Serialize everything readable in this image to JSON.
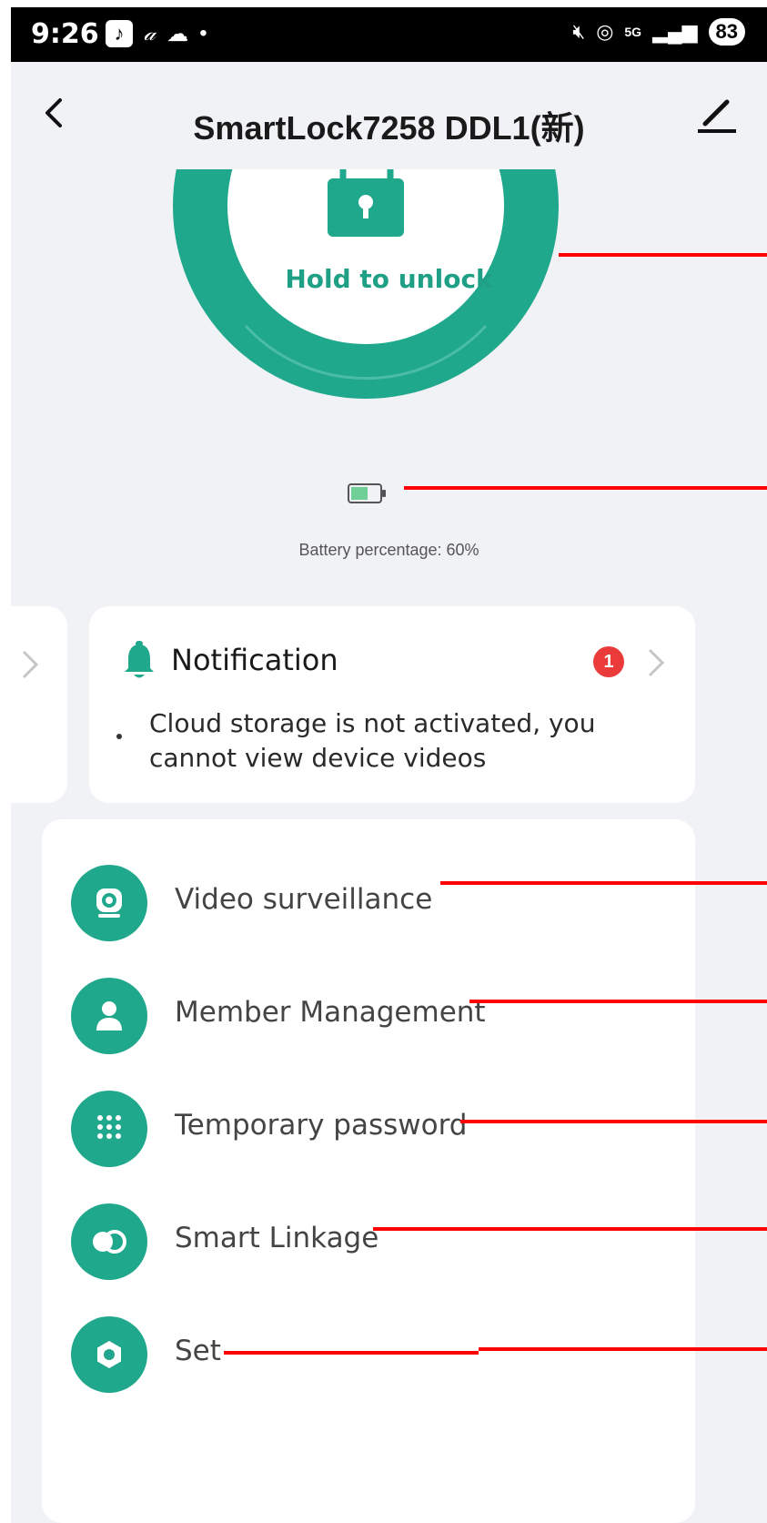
{
  "status_bar": {
    "time": "9:26",
    "battery": "83",
    "icons": [
      "tiktok-icon",
      "signature-icon",
      "cloud-icon",
      "dot-icon",
      "mute-icon",
      "hotspot-icon",
      "5g-icon",
      "signal-icon"
    ]
  },
  "app_bar": {
    "title": "SmartLock7258  DDL1(新)",
    "back_icon": "chevron-left-icon",
    "edit_icon": "pencil-icon"
  },
  "unlock": {
    "label": "Hold to unlock",
    "icon": "padlock-icon",
    "accent": "#1fa88c"
  },
  "battery": {
    "text": "Battery percentage: 60%",
    "level": 0.6
  },
  "notification": {
    "title": "Notification",
    "count": "1",
    "message": "Cloud storage is not activated, you cannot view device videos",
    "badge_color": "#ea3a3a"
  },
  "menu": {
    "items": [
      {
        "label": "Video surveillance",
        "icon": "camera-icon"
      },
      {
        "label": "Member Management",
        "icon": "person-icon"
      },
      {
        "label": "Temporary password",
        "icon": "keypad-icon"
      },
      {
        "label": "Smart Linkage",
        "icon": "toggle-icon"
      },
      {
        "label": "Set",
        "icon": "gear-icon"
      }
    ]
  }
}
